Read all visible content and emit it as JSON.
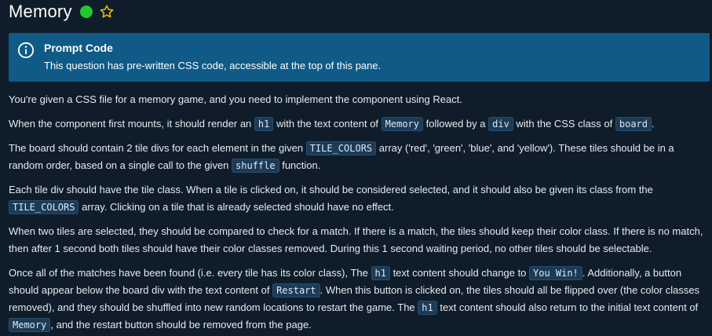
{
  "header": {
    "title": "Memory",
    "status_color": "#1fca2f",
    "star_icon": "star-outline-icon"
  },
  "prompt": {
    "icon": "info-icon",
    "title": "Prompt Code",
    "text": "This question has pre-written CSS code, accessible at the top of this pane."
  },
  "body": {
    "p1": "You're given a CSS file for a memory game, and you need to implement the component using React.",
    "p2": {
      "t1": "When the component first mounts, it should render an ",
      "c1": "h1",
      "t2": " with the text content of ",
      "c2": "Memory",
      "t3": " followed by a ",
      "c3": "div",
      "t4": " with the CSS class of ",
      "c4": "board",
      "t5": "."
    },
    "p3": {
      "t1": "The board should contain 2 tile divs for each element in the given ",
      "c1": "TILE_COLORS",
      "t2": " array ('red', 'green', 'blue', and 'yellow'). These tiles should be in a random order, based on a single call to the given ",
      "c2": "shuffle",
      "t3": " function."
    },
    "p4": {
      "t1": "Each tile div should have the tile class. When a tile is clicked on, it should be considered selected, and it should also be given its class from the ",
      "c1": "TILE_COLORS",
      "t2": " array. Clicking on a tile that is already selected should have no effect."
    },
    "p5": "When two tiles are selected, they should be compared to check for a match. If there is a match, the tiles should keep their color class. If there is no match, then after 1 second both tiles should have their color classes removed. During this 1 second waiting period, no other tiles should be selectable.",
    "p6": {
      "t1": "Once all of the matches have been found (i.e. every tile has its color class), The ",
      "c1": "h1",
      "t2": " text content should change to ",
      "c2": "You Win!",
      "t3": ". Additionally, a button should appear below the board div with the text content of ",
      "c3": "Restart",
      "t4": ". When this button is clicked on, the tiles should all be flipped over (the color classes removed), and they should be shuffled into new random locations to restart the game. The ",
      "c4": "h1",
      "t5": " text content should also return to the initial text content of ",
      "c5": "Memory",
      "t6": ", and the restart button should be removed from the page."
    }
  }
}
